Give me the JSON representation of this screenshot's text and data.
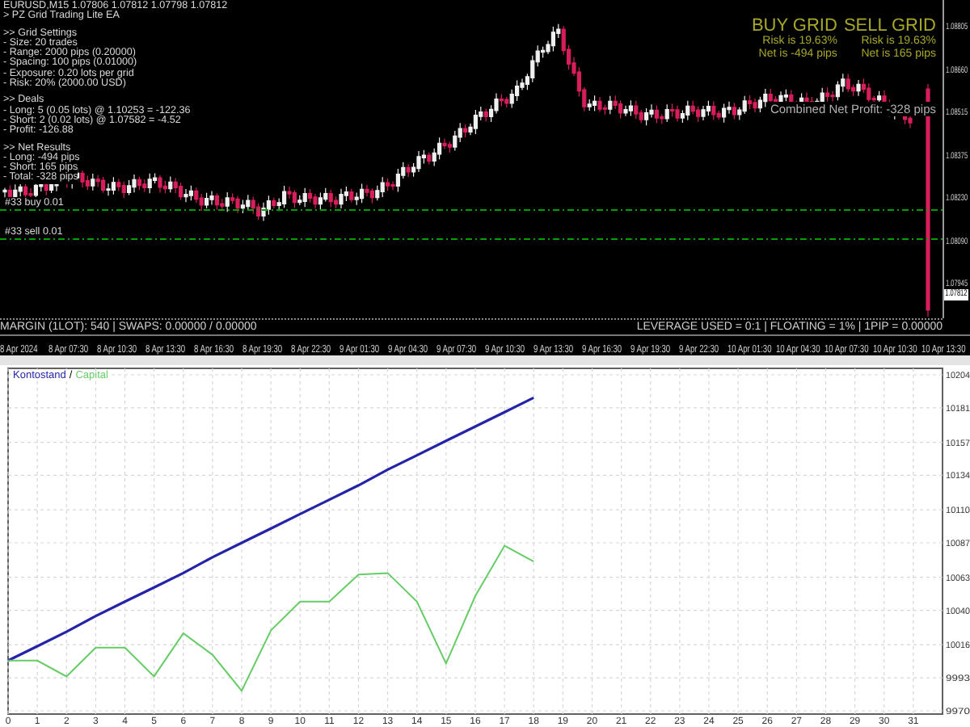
{
  "price_chart": {
    "symbol_line": "EURUSD,M15 1.07806 1.07812 1.07798 1.07812",
    "ea_name": "> PZ Grid Trading Lite EA",
    "info_groups": [
      {
        "heading": ">> Grid Settings",
        "lines": [
          "- Size: 20 trades",
          "- Range: 2000 pips (0.20000)",
          "- Spacing: 100 pips (0.01000)",
          "- Exposure: 0.20 lots per grid",
          "- Risk: 20% (2000.00 USD)"
        ]
      },
      {
        "heading": ">> Deals",
        "lines": [
          "- Long: 5 (0.05 lots) @ 1.10253 = -122.36",
          "- Short: 2 (0.02 lots) @ 1.07582 = -4.52",
          "- Profit: -126.88"
        ]
      },
      {
        "heading": ">> Net Results",
        "lines": [
          "- Long: -494 pips",
          "- Short: 165 pips",
          "- Total: -328 pips"
        ]
      }
    ],
    "grid_panel": {
      "columns": [
        {
          "title": "BUY GRID",
          "risk": "Risk is 19.63%",
          "net": "Net is -494 pips"
        },
        {
          "title": "SELL GRID",
          "risk": "Risk is 19.63%",
          "net": "Net is 165 pips"
        }
      ],
      "combined": "Combined Net Profit: -328 pips"
    },
    "order_lines": [
      {
        "label": "#33 buy 0.01"
      },
      {
        "label": "#33 sell 0.01"
      }
    ],
    "price_axis": [
      "1.08805",
      "1.08660",
      "1.08515",
      "1.08375",
      "1.08230",
      "1.08090",
      "1.07945"
    ],
    "current_price": "1.07812",
    "status_left": "MARGIN (1LOT): 540 | SWAPS: 0.00000 / 0.00000",
    "status_right": "LEVERAGE USED = 0:1 | FLOATING = 1% | 1PIP = 0.00000",
    "time_axis": [
      "8 Apr 2024",
      "8 Apr 07:30",
      "8 Apr 10:30",
      "8 Apr 13:30",
      "8 Apr 16:30",
      "8 Apr 19:30",
      "8 Apr 22:30",
      "9 Apr 01:30",
      "9 Apr 04:30",
      "9 Apr 07:30",
      "9 Apr 10:30",
      "9 Apr 13:30",
      "9 Apr 16:30",
      "9 Apr 19:30",
      "9 Apr 22:30",
      "10 Apr 01:30",
      "10 Apr 04:30",
      "10 Apr 07:30",
      "10 Apr 10:30",
      "10 Apr 13:30"
    ]
  },
  "equity_chart": {
    "legend_separator": "/",
    "chart_data": {
      "type": "line",
      "x": [
        0,
        1,
        2,
        3,
        4,
        5,
        6,
        7,
        8,
        9,
        10,
        11,
        12,
        13,
        14,
        15,
        16,
        17,
        18
      ],
      "series": [
        {
          "name": "Kontostand",
          "color": "#2424a8",
          "values": [
            10005,
            10015,
            10025,
            10036,
            10046,
            10056,
            10066,
            10077,
            10087,
            10097,
            10107,
            10117,
            10127,
            10138,
            10148,
            10158,
            10168,
            10178,
            10188
          ]
        },
        {
          "name": "Capital",
          "color": "#66cc66",
          "values": [
            10005,
            10005,
            9994,
            10014,
            10014,
            9994,
            10024,
            10009,
            9984,
            10026,
            10046,
            10046,
            10065,
            10066,
            10046,
            10003,
            10050,
            10085,
            10074
          ]
        }
      ],
      "xlim": [
        0,
        32
      ],
      "ylim": [
        9970,
        10204
      ],
      "xticks": [
        0,
        1,
        2,
        3,
        4,
        5,
        6,
        7,
        8,
        9,
        10,
        11,
        12,
        13,
        14,
        15,
        16,
        17,
        18,
        19,
        20,
        21,
        22,
        23,
        24,
        25,
        26,
        27,
        28,
        29,
        30,
        31
      ],
      "yticks": [
        9970,
        9993,
        10016,
        10040,
        10063,
        10087,
        10110,
        10134,
        10157,
        10181,
        10204
      ],
      "grid": true
    }
  }
}
